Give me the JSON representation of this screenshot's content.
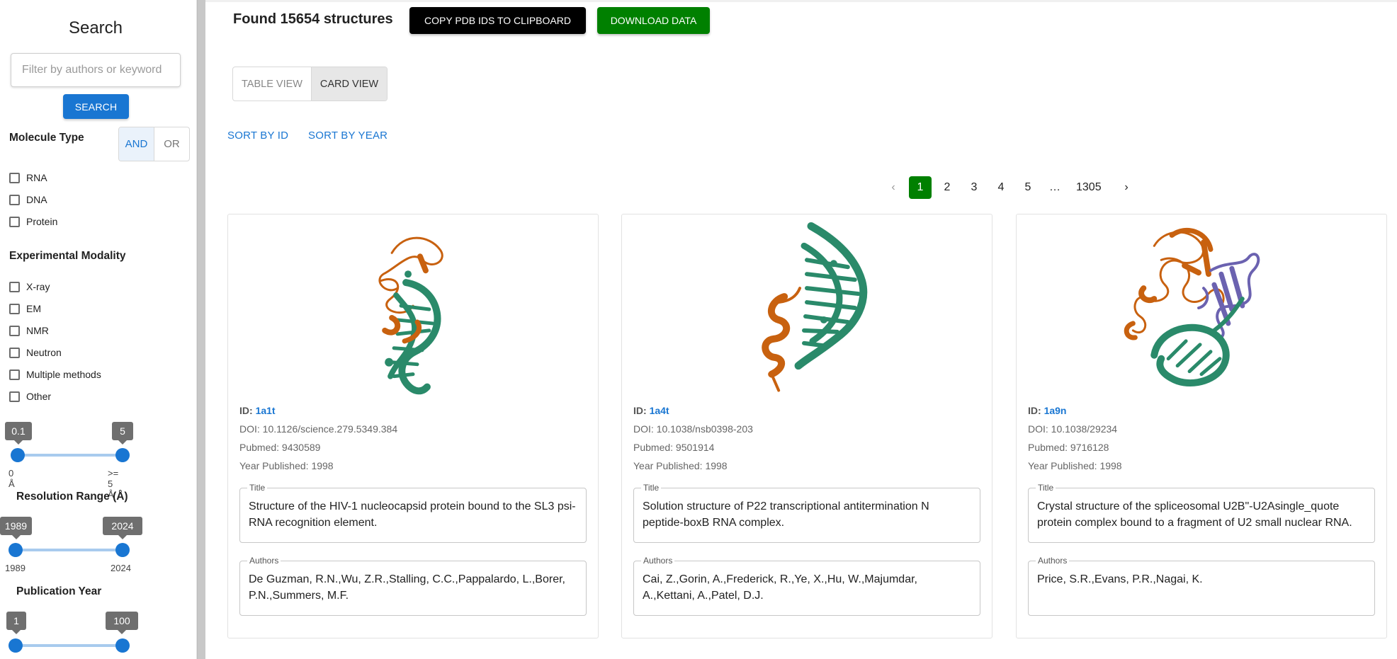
{
  "sidebar": {
    "title": "Search",
    "search_placeholder": "Filter by authors or keyword",
    "search_button": "SEARCH",
    "molecule_type": {
      "heading": "Molecule Type",
      "and_label": "AND",
      "or_label": "OR",
      "options": [
        "RNA",
        "DNA",
        "Protein"
      ]
    },
    "modality": {
      "heading": "Experimental Modality",
      "options": [
        "X-ray",
        "EM",
        "NMR",
        "Neutron",
        "Multiple methods",
        "Other"
      ]
    },
    "resolution": {
      "heading": "Resolution Range (Å)",
      "low_value": "0.1",
      "high_value": "5",
      "min_mark": "0 Å",
      "max_mark": ">= 5 Å"
    },
    "year": {
      "heading": "Publication Year",
      "low_value": "1989",
      "high_value": "2024",
      "min_mark": "1989",
      "max_mark": "2024"
    },
    "third": {
      "low_value": "1",
      "high_value": "100"
    }
  },
  "header": {
    "found_text": "Found 15654 structures",
    "copy_button": "COPY PDB IDS TO CLIPBOARD",
    "download_button": "DOWNLOAD DATA"
  },
  "views": {
    "table": "TABLE VIEW",
    "card": "CARD VIEW"
  },
  "sort": {
    "by_id": "SORT BY ID",
    "by_year": "SORT BY YEAR"
  },
  "pagination": {
    "prev": "‹",
    "pages": [
      "1",
      "2",
      "3",
      "4",
      "5"
    ],
    "ellipsis": "…",
    "last": "1305",
    "next": "›"
  },
  "labels": {
    "id": "ID:",
    "title_legend": "Title",
    "authors_legend": "Authors"
  },
  "cards": [
    {
      "id": "1a1t",
      "doi": "DOI: 10.1126/science.279.5349.384",
      "pubmed": "Pubmed: 9430589",
      "year": "Year Published: 1998",
      "title": "Structure of the HIV-1 nucleocapsid protein bound to the SL3 psi-RNA recognition element.",
      "authors": "De Guzman, R.N.,Wu, Z.R.,Stalling, C.C.,Pappalardo, L.,Borer, P.N.,Summers, M.F."
    },
    {
      "id": "1a4t",
      "doi": "DOI: 10.1038/nsb0398-203",
      "pubmed": "Pubmed: 9501914",
      "year": "Year Published: 1998",
      "title": "Solution structure of P22 transcriptional antitermination N peptide-boxB RNA complex.",
      "authors": "Cai, Z.,Gorin, A.,Frederick, R.,Ye, X.,Hu, W.,Majumdar, A.,Kettani, A.,Patel, D.J."
    },
    {
      "id": "1a9n",
      "doi": "DOI: 10.1038/29234",
      "pubmed": "Pubmed: 9716128",
      "year": "Year Published: 1998",
      "title": "Crystal structure of the spliceosomal U2B\"-U2Asingle_quote protein complex bound to a fragment of U2 small nuclear RNA.",
      "authors": "Price, S.R.,Evans, P.R.,Nagai, K."
    }
  ],
  "colors": {
    "primary": "#1976d2",
    "green": "#008000",
    "rna": "#2a8a6a",
    "protein": "#c8610f",
    "protein2": "#6b62b0"
  }
}
